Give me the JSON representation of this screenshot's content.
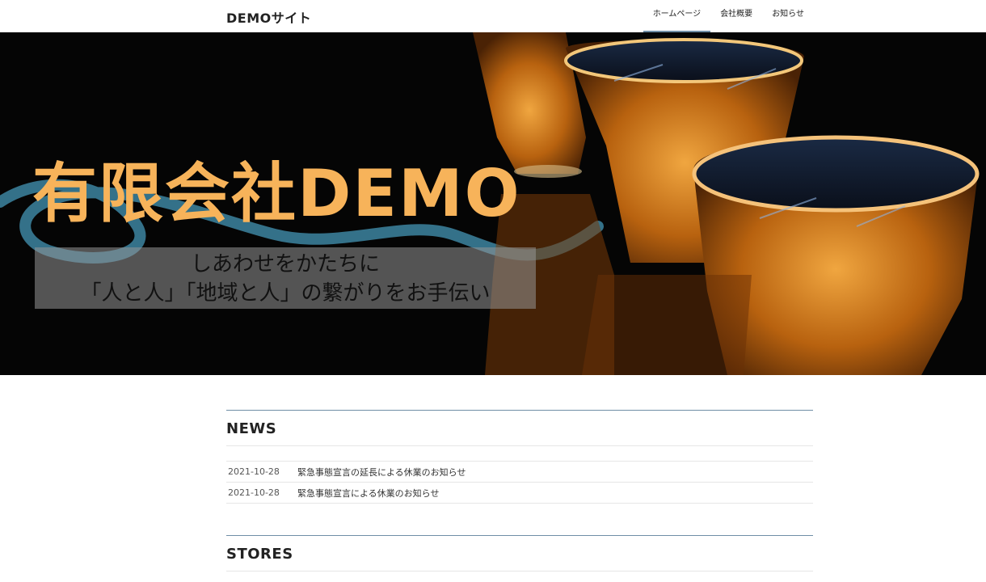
{
  "header": {
    "site_title": "DEMOサイト",
    "nav": [
      {
        "label": "ホームページ",
        "active": true
      },
      {
        "label": "会社概要",
        "active": false
      },
      {
        "label": "お知らせ",
        "active": false
      }
    ]
  },
  "hero": {
    "title": "有限会社DEMO",
    "tagline_line1": "しあわせをかたちに",
    "tagline_line2": "「人と人」「地域と人」の繋がりをお手伝い"
  },
  "news": {
    "heading": "NEWS",
    "items": [
      {
        "date": "2021-10-28",
        "text": "緊急事態宣言の延長による休業のお知らせ"
      },
      {
        "date": "2021-10-28",
        "text": "緊急事態宣言による休業のお知らせ"
      }
    ]
  },
  "stores": {
    "heading": "STORES"
  },
  "colors": {
    "accent_rule": "#6f8ea6",
    "hero_title": "#f7b35a",
    "hero_background": "#050505"
  }
}
